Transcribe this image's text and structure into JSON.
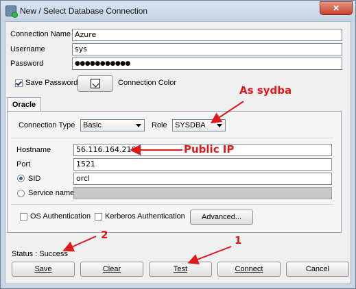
{
  "window": {
    "title": "New / Select Database Connection",
    "close_label": "✕"
  },
  "form": {
    "connection_name": {
      "label": "Connection Name",
      "value": "Azure"
    },
    "username": {
      "label": "Username",
      "value": "sys"
    },
    "password": {
      "label": "Password",
      "value": "●●●●●●●●●●●"
    },
    "save_password": {
      "label": "Save Password",
      "checked": true
    },
    "connection_color": {
      "label": "Connection Color"
    }
  },
  "tabs": [
    {
      "label": "Oracle",
      "selected": true
    }
  ],
  "oracle": {
    "connection_type": {
      "label": "Connection Type",
      "value": "Basic"
    },
    "role": {
      "label": "Role",
      "value": "SYSDBA"
    },
    "hostname": {
      "label": "Hostname",
      "value": "56.116.164.216"
    },
    "port": {
      "label": "Port",
      "value": "1521"
    },
    "sid": {
      "label": "SID",
      "value": "orcl",
      "selected": true
    },
    "service_name": {
      "label": "Service name",
      "value": ""
    },
    "os_auth": {
      "label": "OS Authentication",
      "checked": false
    },
    "kerberos_auth": {
      "label": "Kerberos Authentication",
      "checked": false
    },
    "advanced_label": "Advanced..."
  },
  "status": "Status : Success",
  "buttons": {
    "save": "Save",
    "clear": "Clear",
    "test": "Test",
    "connect": "Connect",
    "cancel": "Cancel"
  },
  "annotations": {
    "as_sydba": "As sydba",
    "public_ip": "Public IP",
    "step_1": "1",
    "step_2": "2",
    "color": "#e11919"
  }
}
